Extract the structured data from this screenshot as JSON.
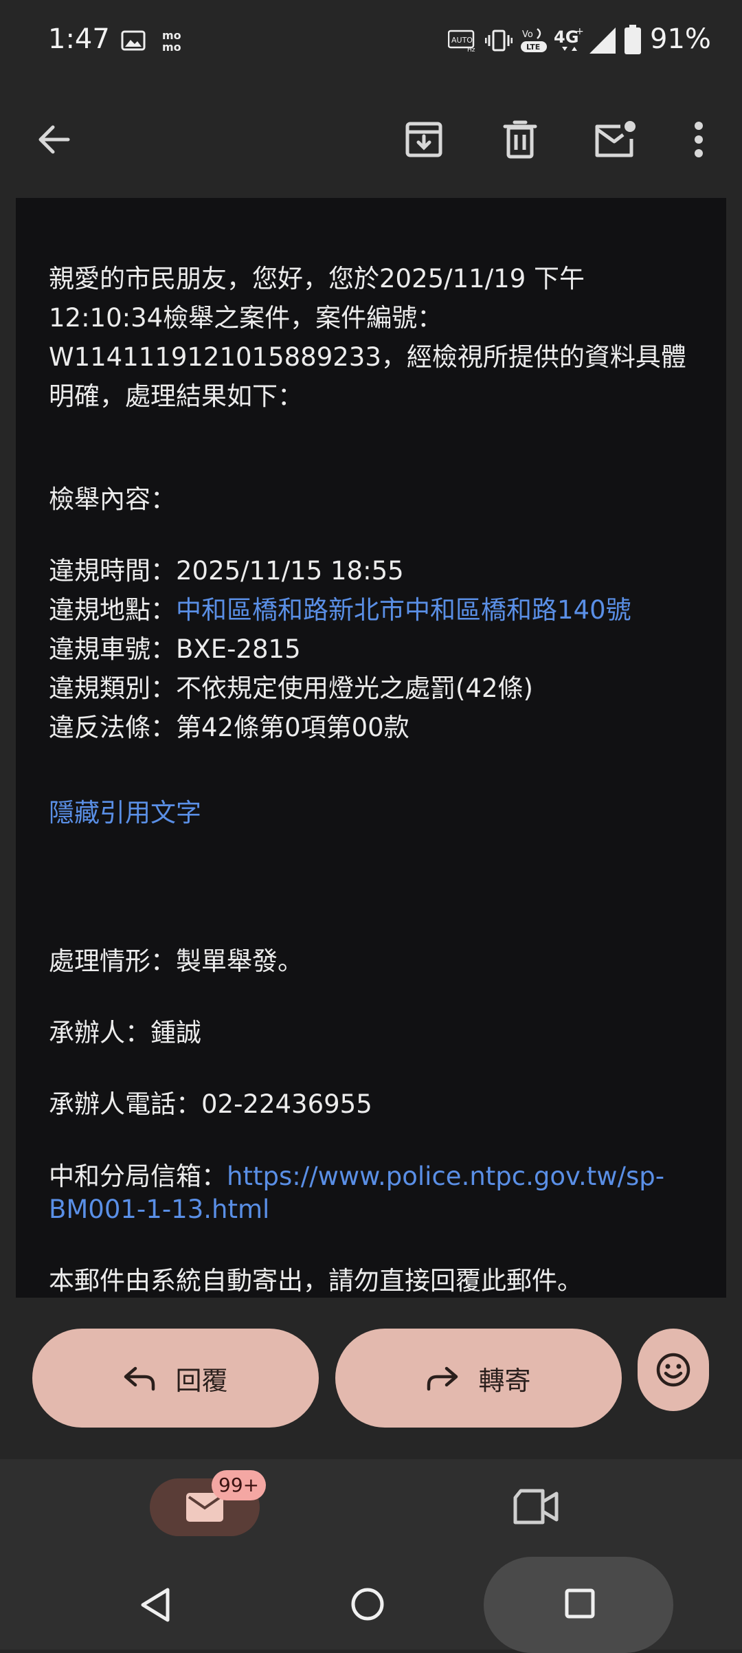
{
  "status_bar": {
    "time": "1:47",
    "battery_percent": "91%",
    "icons": [
      "gallery-icon",
      "momo-icon",
      "auto-hz-icon",
      "vibrate-icon",
      "volte-icon",
      "4g-icon",
      "signal-icon",
      "battery-icon"
    ]
  },
  "toolbar": {
    "icons": [
      "back-arrow-icon",
      "archive-icon",
      "delete-icon",
      "mark-unread-icon",
      "more-vert-icon"
    ]
  },
  "email": {
    "para1_line1": "親愛的市民朋友，您好，您於2025/11/19 下午",
    "para1_line2": "12:10:34檢舉之案件，案件編號：",
    "para1_line3": "W1141119121015889233，經檢視所提供的資料具體",
    "para1_line4": "明確，處理結果如下：",
    "report_heading": "檢舉內容：",
    "time_label": "違規時間：",
    "time_value": "2025/11/15 18:55",
    "location_label": "違規地點：",
    "location_value": "中和區橋和路新北市中和區橋和路140號",
    "plate_label": "違規車號：",
    "plate_value": "BXE-2815",
    "type_label": "違規類別：",
    "type_value": "不依規定使用燈光之處罰(42條)",
    "law_label": "違反法條：",
    "law_value": "第42條第0項第00款",
    "hide_quoted": "隱藏引用文字",
    "status_label": "處理情形：",
    "status_value": "製單舉發。",
    "officer_label": "承辦人：",
    "officer_value": "鍾誠",
    "phone_label": "承辦人電話：",
    "phone_value": "02-22436955",
    "mailbox_label": "中和分局信箱：",
    "mailbox_link_line1": "https://www.police.ntpc.gov.tw/sp-",
    "mailbox_link_line2": "BM001-1-13.html",
    "footer_note": "本郵件由系統自動寄出，請勿直接回覆此郵件。"
  },
  "actions": {
    "reply_label": "回覆",
    "forward_label": "轉寄"
  },
  "bottom_nav": {
    "mail_badge": "99+"
  },
  "colors": {
    "accent_link": "#5a8fe6",
    "action_button": "#e3b9ae",
    "background": "#262626",
    "card": "#111113"
  }
}
